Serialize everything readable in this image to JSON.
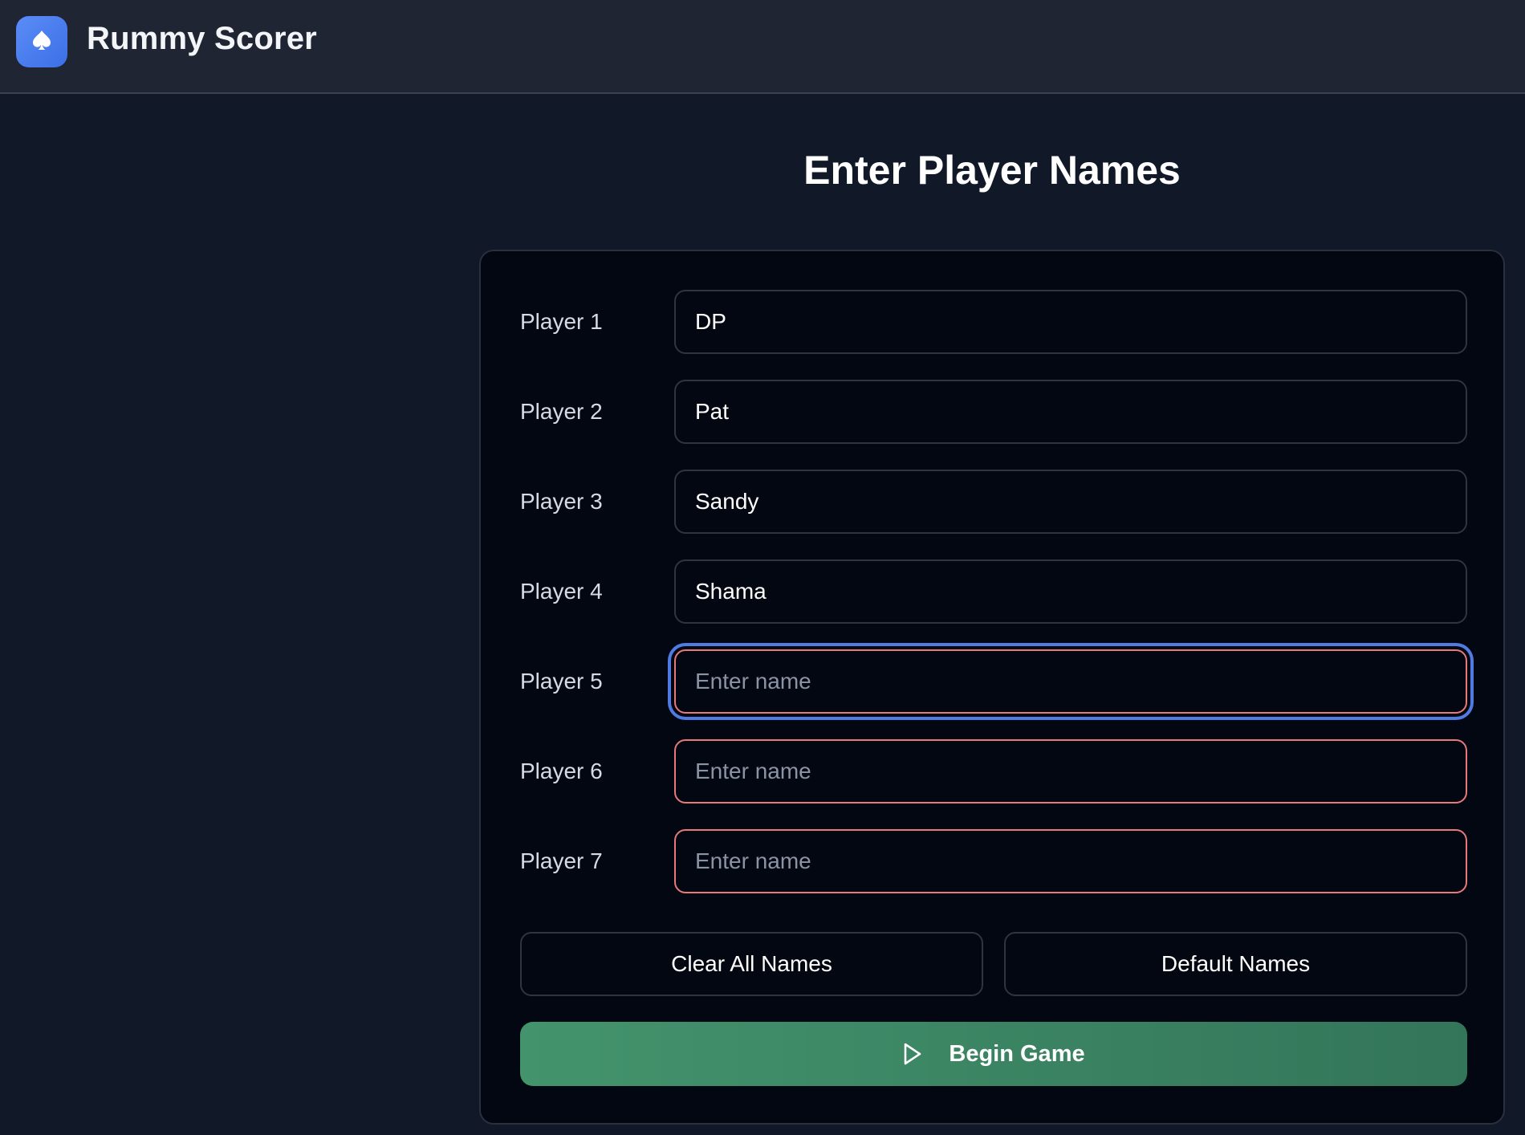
{
  "header": {
    "app_title": "Rummy Scorer",
    "logo_icon": "spade-icon"
  },
  "page": {
    "title": "Enter Player Names"
  },
  "players": [
    {
      "label": "Player 1",
      "value": "DP",
      "placeholder": "Enter name"
    },
    {
      "label": "Player 2",
      "value": "Pat",
      "placeholder": "Enter name"
    },
    {
      "label": "Player 3",
      "value": "Sandy",
      "placeholder": "Enter name"
    },
    {
      "label": "Player 4",
      "value": "Shama",
      "placeholder": "Enter name"
    },
    {
      "label": "Player 5",
      "value": "",
      "placeholder": "Enter name"
    },
    {
      "label": "Player 6",
      "value": "",
      "placeholder": "Enter name"
    },
    {
      "label": "Player 7",
      "value": "",
      "placeholder": "Enter name"
    }
  ],
  "actions": {
    "clear_label": "Clear All Names",
    "default_label": "Default Names",
    "begin_label": "Begin Game",
    "begin_icon": "play-icon"
  },
  "colors": {
    "background": "#111827",
    "header": "#1f2533",
    "card": "#030712",
    "logo": "#4a7ef0",
    "invalid_border": "#e8787a",
    "focus_ring": "#4f7be3",
    "begin_button": "#3d8a66"
  }
}
